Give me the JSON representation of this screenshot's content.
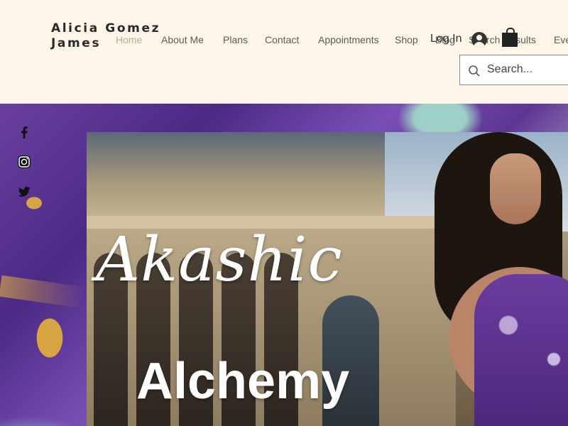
{
  "header": {
    "site_title": "Alicia Gomez James",
    "nav": [
      "Home",
      "About Me",
      "Plans",
      "Contact",
      "Appointments",
      "Shop",
      "Blog",
      "Search Results",
      "Eve"
    ],
    "active_nav": "Home",
    "login_label": "Log In"
  },
  "search": {
    "placeholder": "Search..."
  },
  "social": [
    "facebook-icon",
    "instagram-icon",
    "twitter-icon"
  ],
  "hero": {
    "title_script": "Akashic",
    "title_sub": "Alchemy"
  }
}
